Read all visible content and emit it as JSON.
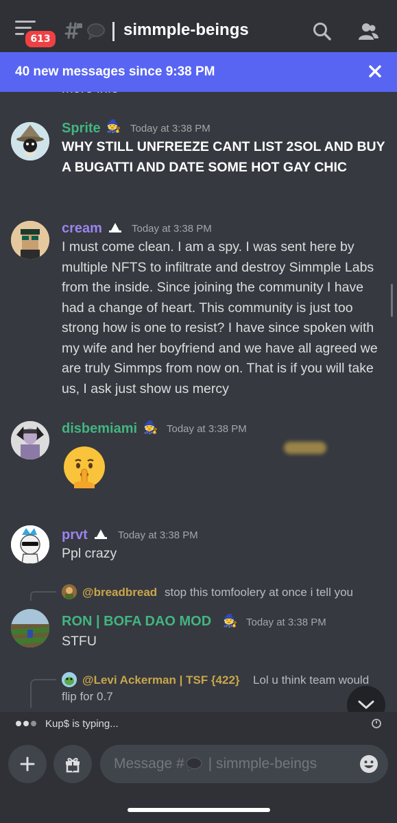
{
  "topbar": {
    "badge_count": "613",
    "channel_name": "simmple-beings",
    "separator": "|"
  },
  "banner": {
    "text": "40 new messages since 9:38 PM"
  },
  "cutoff_text": "more info",
  "messages": [
    {
      "username": "Sprite",
      "username_color": "#43b581",
      "timestamp": "Today at 3:38 PM",
      "content": " WHY STILL UNFREEZE CANT LIST 2SOL AND BUY A BUGATTI AND DATE SOME HOT GAY CHIC"
    },
    {
      "username": "cream",
      "username_color": "#9b84ee",
      "timestamp": "Today at 3:38 PM",
      "content": "I must come clean. I am a spy. I was sent here by multiple NFTS to infiltrate and destroy Simmple Labs from the inside. Since joining the community I have had a change of heart. This community is just too strong how is one to resist? I have since spoken with my wife and her boyfriend and we have all agreed we are truly Simmps from now on. That is if you will take us, I ask just show us mercy"
    },
    {
      "username": "disbemiami",
      "username_color": "#43b581",
      "timestamp": "Today at 3:38 PM",
      "content_emoji": "shushing-face"
    },
    {
      "username": "prvt",
      "username_color": "#9b84ee",
      "timestamp": "Today at 3:38 PM",
      "content": "Ppl crazy"
    },
    {
      "reply_user": "@breadbread",
      "reply_user_color": "#c9a64b",
      "reply_text": "stop this tomfoolery at once i tell you",
      "username": "RON | BOFA DAO MOD",
      "username_color": "#43b581",
      "timestamp": "Today at 3:38 PM",
      "content": "STFU"
    },
    {
      "reply_user": "@Levi Ackerman | TSF {422}",
      "reply_user_color": "#c9a64b",
      "reply_text_line1": "Lol u think team would",
      "reply_text_line2": "flip for  0.7"
    }
  ],
  "typing": {
    "text": "Kup$ is typing..."
  },
  "composer": {
    "placeholder": "Message #      | simmple-beings"
  },
  "colors": {
    "background": "#36393f",
    "topbar": "#2f3136",
    "banner": "#5865f2",
    "badge": "#ed4245"
  }
}
